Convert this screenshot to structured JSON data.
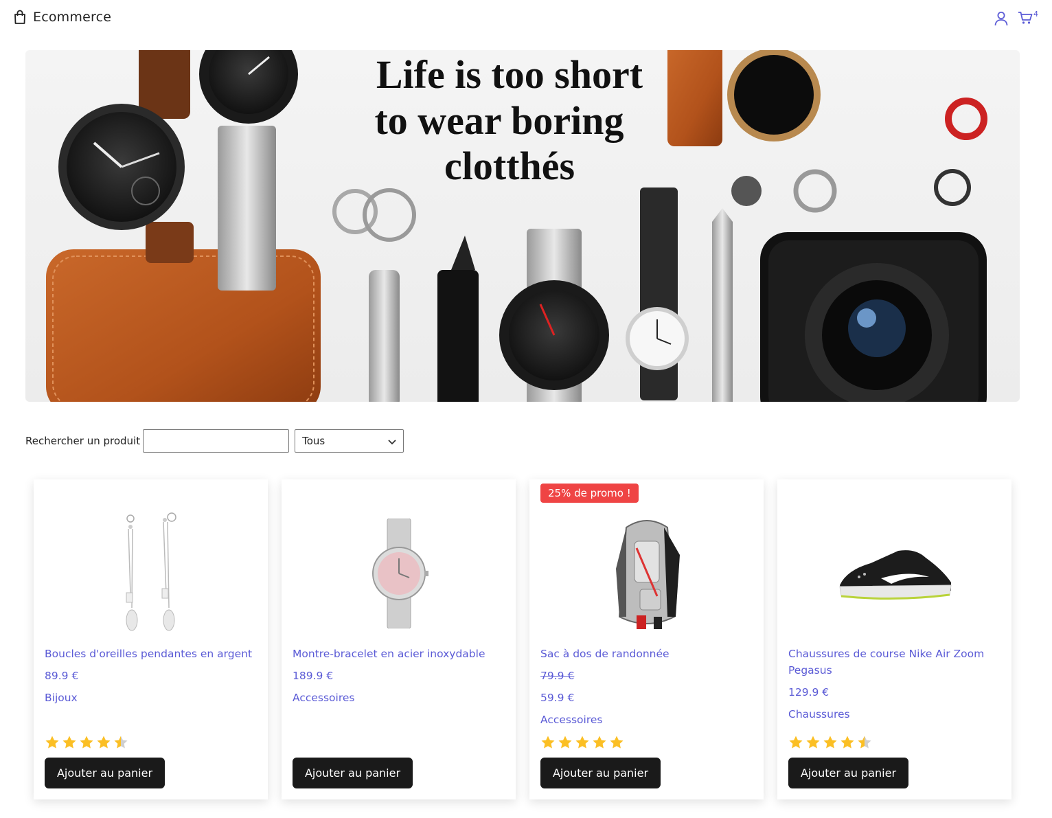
{
  "header": {
    "brand": "Ecommerce",
    "cart_count": "4"
  },
  "hero": {
    "headline_lines": [
      "Life is too short",
      "to wear boring",
      "clotthés"
    ]
  },
  "search": {
    "label": "Rechercher un produit",
    "value": "",
    "category_selected": "Tous"
  },
  "colors": {
    "accent": "#5b5bd6",
    "star": "#fbbf24",
    "badge": "#ef4444",
    "button": "#1a1a1a"
  },
  "products": [
    {
      "title": "Boucles d'oreilles pendantes en argent",
      "price": "89.9 €",
      "category": "Bijoux",
      "rating": 4.5,
      "button": "Ajouter au panier",
      "image_icon": "earrings-image"
    },
    {
      "title": "Montre-bracelet en acier inoxydable",
      "price": "189.9 €",
      "category": "Accessoires",
      "button": "Ajouter au panier",
      "image_icon": "watch-image"
    },
    {
      "badge": "25% de promo !",
      "title": "Sac à dos de randonnée",
      "old_price": "79.9 €",
      "price": "59.9 €",
      "category": "Accessoires",
      "rating": 5,
      "button": "Ajouter au panier",
      "image_icon": "backpack-image"
    },
    {
      "title": "Chaussures de course Nike Air Zoom Pegasus",
      "price": "129.9 €",
      "category": "Chaussures",
      "rating": 4.5,
      "button": "Ajouter au panier",
      "image_icon": "shoe-image"
    }
  ]
}
